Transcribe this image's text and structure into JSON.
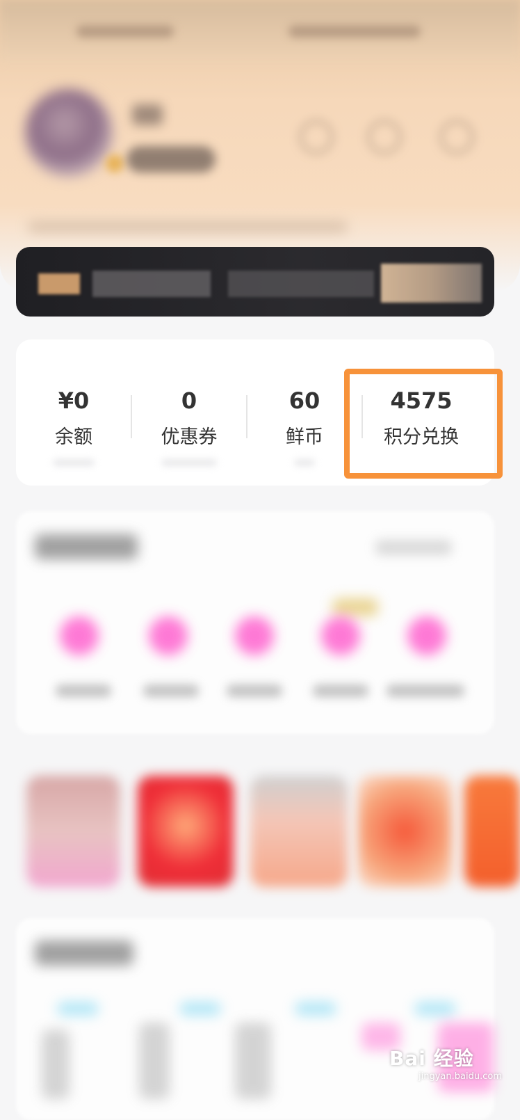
{
  "assets": {
    "items": [
      {
        "value": "¥0",
        "label": "余额"
      },
      {
        "value": "0",
        "label": "优惠券"
      },
      {
        "value": "60",
        "label": "鲜币"
      },
      {
        "value": "4575",
        "label": "积分兑换"
      }
    ],
    "highlighted_index": 3,
    "highlight_color": "#f7923a"
  },
  "watermark": {
    "brand": "Bai  经验",
    "sub": "jingyan.baidu.com"
  },
  "colors": {
    "header_accent": "#f6d8ba",
    "member_card": "#1f1f23",
    "service_icon": "#ff63cf"
  }
}
